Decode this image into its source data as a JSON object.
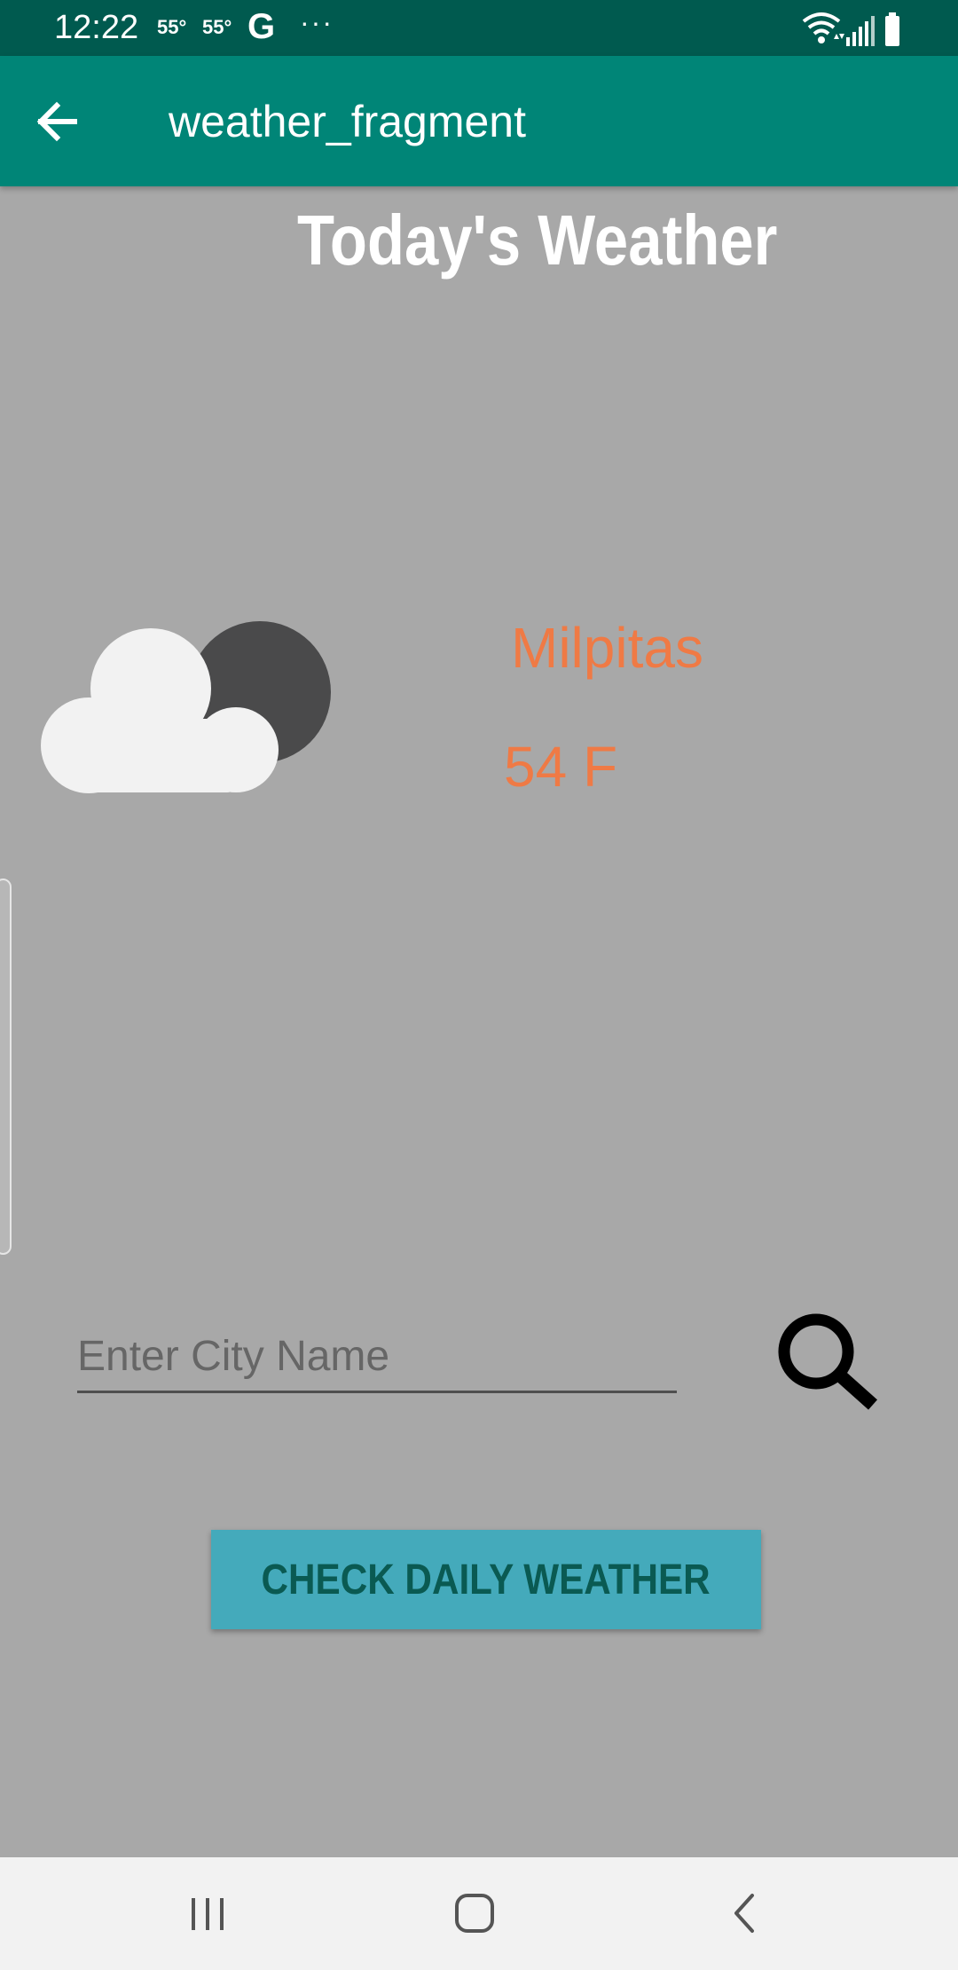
{
  "status_bar": {
    "time": "12:22",
    "temp1": "55°",
    "temp2": "55°",
    "g_label": "G",
    "more": "···"
  },
  "app_bar": {
    "title": "weather_fragment",
    "back_icon": "arrow-back-icon"
  },
  "main": {
    "heading": "Today's Weather",
    "city": "Milpitas",
    "temperature": "54 F",
    "condition_icon": "partly-cloudy-night-icon"
  },
  "search": {
    "placeholder": "Enter City Name",
    "value": "",
    "icon": "search-icon"
  },
  "actions": {
    "check_label": "CHECK DAILY WEATHER"
  },
  "nav_bar": {
    "recents": "recents-icon",
    "home": "home-icon",
    "back": "back-icon"
  },
  "colors": {
    "status_bar": "#005a4f",
    "app_bar": "#008577",
    "background": "#a8a8a8",
    "accent_text": "#ef7a45",
    "button": "#44aabb",
    "button_text": "#0a5a52"
  }
}
